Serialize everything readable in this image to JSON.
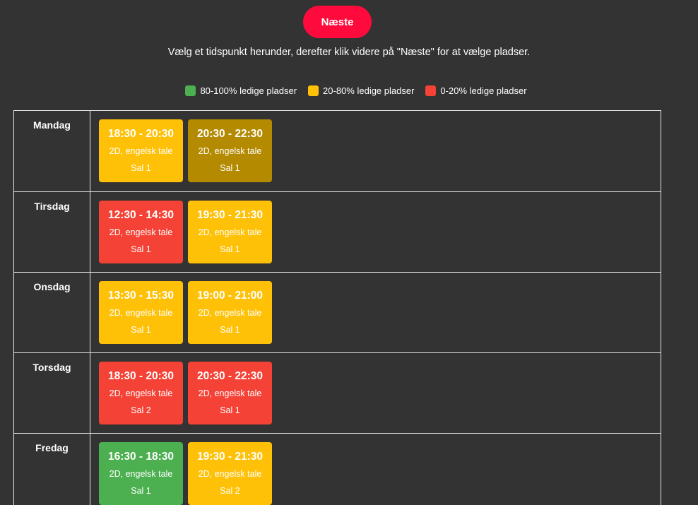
{
  "header": {
    "next_label": "Næste",
    "instruction": "Vælg et tidspunkt herunder, derefter klik videre på \"Næste\" for at vælge pladser."
  },
  "legend": [
    {
      "label": "80-100% ledige pladser",
      "color": "#4caf50"
    },
    {
      "label": "20-80% ledige pladser",
      "color": "#ffc107"
    },
    {
      "label": "0-20% ledige pladser",
      "color": "#f44336"
    }
  ],
  "days": [
    {
      "name": "Mandag",
      "slots": [
        {
          "time": "18:30 - 20:30",
          "format": "2D, engelsk tale",
          "hall": "Sal 1",
          "availability": "yellow"
        },
        {
          "time": "20:30 - 22:30",
          "format": "2D, engelsk tale",
          "hall": "Sal 1",
          "availability": "dark-yellow"
        }
      ]
    },
    {
      "name": "Tirsdag",
      "slots": [
        {
          "time": "12:30 - 14:30",
          "format": "2D, engelsk tale",
          "hall": "Sal 1",
          "availability": "red"
        },
        {
          "time": "19:30 - 21:30",
          "format": "2D, engelsk tale",
          "hall": "Sal 1",
          "availability": "yellow"
        }
      ]
    },
    {
      "name": "Onsdag",
      "slots": [
        {
          "time": "13:30 - 15:30",
          "format": "2D, engelsk tale",
          "hall": "Sal 1",
          "availability": "yellow"
        },
        {
          "time": "19:00 - 21:00",
          "format": "2D, engelsk tale",
          "hall": "Sal 1",
          "availability": "yellow"
        }
      ]
    },
    {
      "name": "Torsdag",
      "slots": [
        {
          "time": "18:30 - 20:30",
          "format": "2D, engelsk tale",
          "hall": "Sal 2",
          "availability": "red"
        },
        {
          "time": "20:30 - 22:30",
          "format": "2D, engelsk tale",
          "hall": "Sal 1",
          "availability": "red"
        }
      ]
    },
    {
      "name": "Fredag",
      "slots": [
        {
          "time": "16:30 - 18:30",
          "format": "2D, engelsk tale",
          "hall": "Sal 1",
          "availability": "green"
        },
        {
          "time": "19:30 - 21:30",
          "format": "2D, engelsk tale",
          "hall": "Sal 2",
          "availability": "yellow"
        }
      ]
    }
  ]
}
